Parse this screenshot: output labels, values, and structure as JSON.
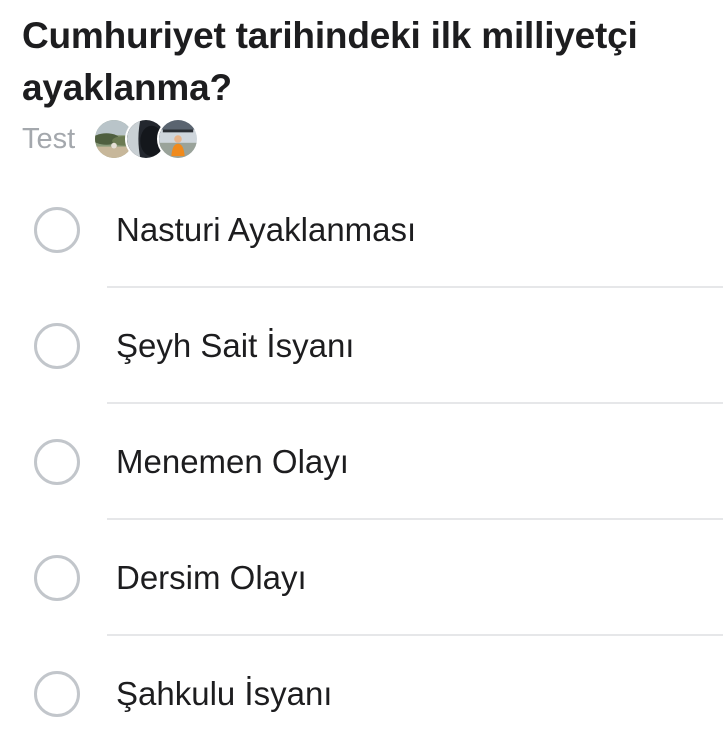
{
  "poll": {
    "question": "Cumhuriyet tarihindeki ilk milliyetçi ayaklanma?",
    "type_label": "Test",
    "voter_avatars": [
      "avatar-landscape",
      "avatar-dark",
      "avatar-person-orange"
    ],
    "options": [
      {
        "label": "Nasturi Ayaklanması",
        "selected": false
      },
      {
        "label": "Şeyh Sait İsyanı",
        "selected": false
      },
      {
        "label": "Menemen Olayı",
        "selected": false
      },
      {
        "label": "Dersim Olayı",
        "selected": false
      },
      {
        "label": "Şahkulu İsyanı",
        "selected": false
      }
    ]
  },
  "colors": {
    "text": "#1d1d1f",
    "muted": "#a4a8ad",
    "radio_border": "#c2c6cb",
    "divider": "#e6e7e9"
  }
}
